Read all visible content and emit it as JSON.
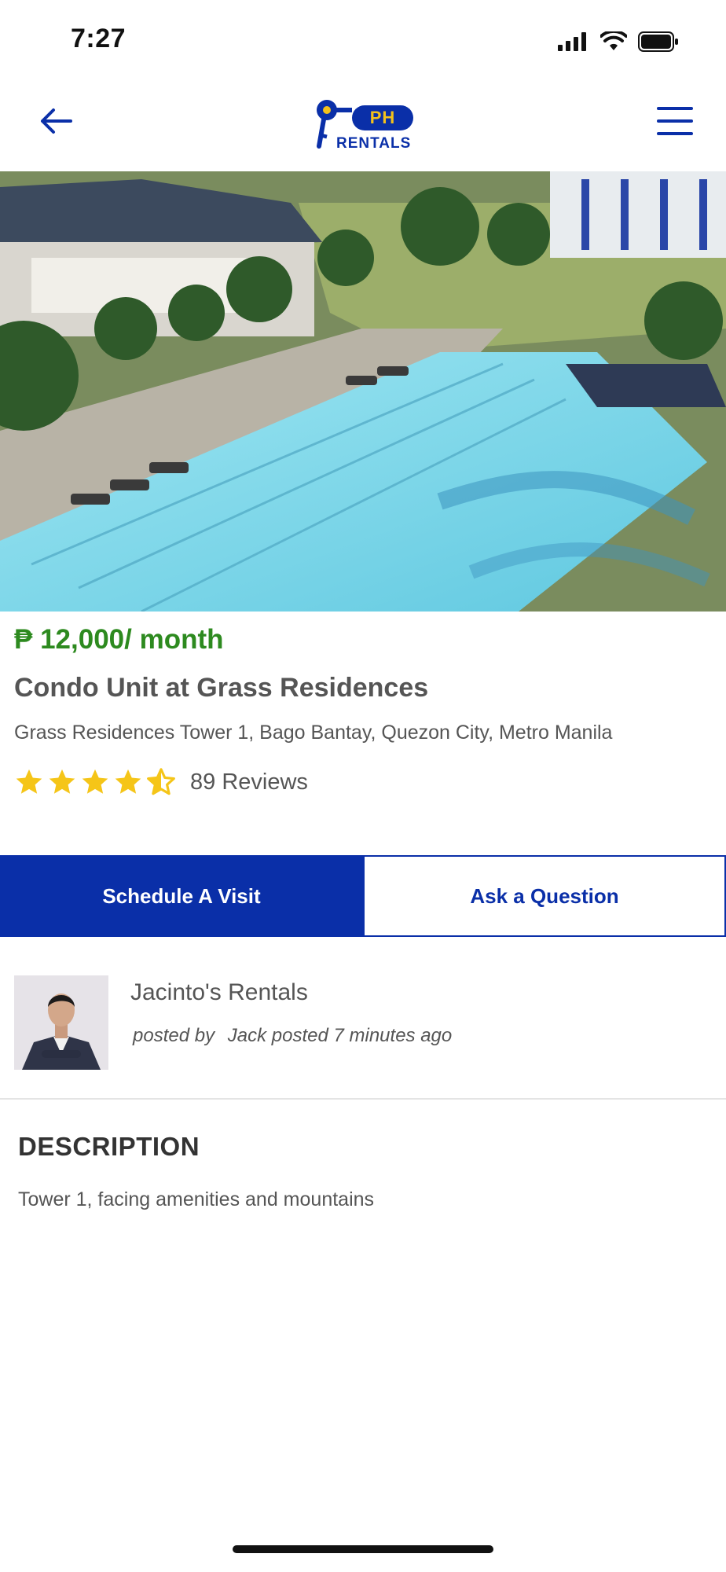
{
  "status_bar": {
    "time": "7:27",
    "icons": [
      "signal-icon",
      "wifi-icon",
      "battery-icon"
    ]
  },
  "nav": {
    "back_icon": "arrow-left-icon",
    "menu_icon": "hamburger-menu-icon",
    "logo": {
      "ph": "PH",
      "rentals": "RENTALS"
    }
  },
  "listing": {
    "price": "₱ 12,000/ month",
    "title": "Condo Unit at Grass Residences",
    "address": "Grass Residences Tower 1, Bago Bantay, Quezon City, Metro Manila",
    "rating": 4.5,
    "rating_max": 5,
    "reviews": "89 Reviews"
  },
  "actions": {
    "schedule_label": "Schedule A Visit",
    "ask_label": "Ask a Question"
  },
  "poster": {
    "name": "Jacinto's Rentals",
    "posted_by_label": "posted by",
    "posted_text": "Jack posted 7 minutes ago"
  },
  "description": {
    "heading": "DESCRIPTION",
    "text": "Tower 1, facing amenities and mountains"
  },
  "colors": {
    "brand_blue": "#0a2fa8",
    "price_green": "#2d8a1f",
    "star_yellow": "#f5c518",
    "logo_yellow": "#f4c21b"
  }
}
